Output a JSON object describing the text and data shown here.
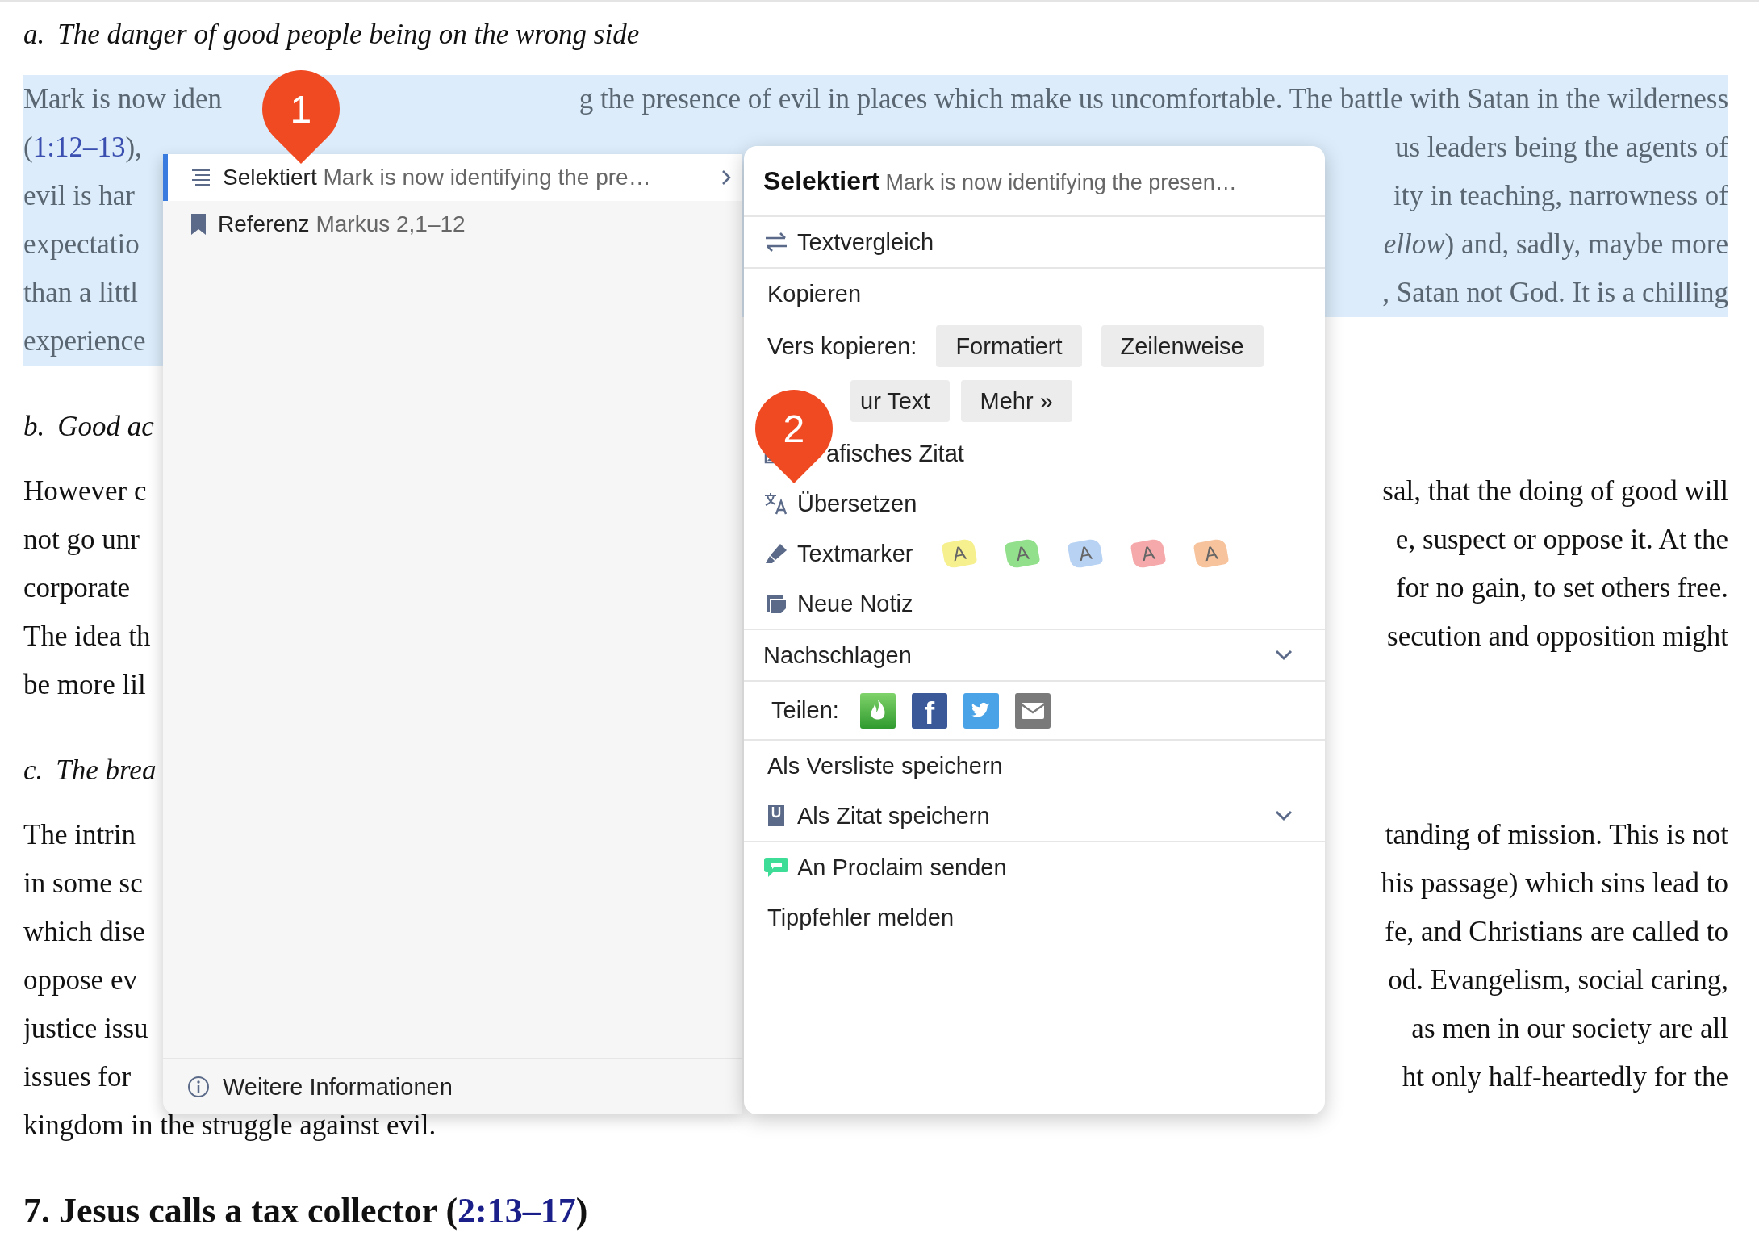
{
  "document": {
    "blocks": [
      {
        "kind": "subheading",
        "label": "a.",
        "title": "The danger of good people being on the wrong side"
      },
      {
        "kind": "paragraph",
        "lines": [
          {
            "selected": true,
            "left": "Mark is now iden",
            "right": "g the presence of evil in places which make us uncomfortable. The battle with Satan in the wilderness"
          },
          {
            "selected": true,
            "left": [
              {
                "kind": "text",
                "text": "("
              },
              {
                "kind": "link",
                "text": "1:12–13"
              },
              {
                "kind": "text",
                "text": "),"
              }
            ],
            "right": "us leaders being the agents of"
          },
          {
            "selected": true,
            "left": "evil is har",
            "right": "ity in teaching, narrowness of"
          },
          {
            "selected": true,
            "left": "expectatio",
            "right": "*ellow*) and, sadly, maybe more"
          },
          {
            "selected": true,
            "left": "than a littl",
            "right": ", Satan not God. It is a chilling"
          },
          {
            "selected": true,
            "left": "experience"
          }
        ]
      },
      {
        "kind": "subheading",
        "label": "b.",
        "title": "Good ac"
      },
      {
        "kind": "paragraph",
        "lines": [
          {
            "selected": false,
            "left": "However c",
            "right": "sal, that the doing of good will"
          },
          {
            "selected": false,
            "left": "not go unr",
            "right": "e, suspect or oppose it.  At the"
          },
          {
            "selected": false,
            "left": "corporate",
            "right": "for no gain, to set others free."
          },
          {
            "selected": false,
            "left": "The idea th",
            "right": "secution and opposition might"
          },
          {
            "selected": false,
            "left": "be more lil"
          }
        ]
      },
      {
        "kind": "subheading",
        "label": "c.",
        "title": "The brea"
      },
      {
        "kind": "paragraph",
        "lines": [
          {
            "selected": false,
            "left": "The intrin",
            "right": "tanding of mission. This is not"
          },
          {
            "selected": false,
            "left": "in some sc",
            "right": "his passage) which sins lead to"
          },
          {
            "selected": false,
            "left": "which dise",
            "right": "fe, and Christians are called to"
          },
          {
            "selected": false,
            "left": "oppose ev",
            "right": "od. Evangelism, social caring,"
          },
          {
            "selected": false,
            "left": "justice issu",
            "right": "as men in our society are all"
          },
          {
            "selected": false,
            "left": "issues for",
            "right": "ht only half-heartedly for the"
          },
          {
            "selected": false,
            "left": "kingdom in the struggle against evil."
          }
        ]
      },
      {
        "kind": "heading",
        "segments": [
          {
            "kind": "text",
            "text": "7. Jesus calls a tax collector ("
          },
          {
            "kind": "link",
            "text": "2:13–17"
          },
          {
            "kind": "text",
            "text": ")"
          }
        ]
      }
    ]
  },
  "popup": {
    "context_items": [
      {
        "kind": "selection",
        "label": "Selektiert",
        "detail": "Mark is now identifying the pre…",
        "selected": true
      },
      {
        "kind": "reference",
        "label": "Referenz",
        "detail": "Markus 2,1–12",
        "selected": false
      }
    ],
    "footer": "Weitere Informationen",
    "header": {
      "label": "Selektiert",
      "detail": "Mark is now identifying the presen…"
    },
    "sections": [
      [
        {
          "kind": "compare",
          "label": "Textvergleich"
        }
      ],
      [
        {
          "kind": "label",
          "label": "Kopieren"
        },
        {
          "kind": "buttons",
          "label": "Vers kopieren:",
          "buttons": [
            "Formatiert",
            "Zeilenweise"
          ]
        },
        {
          "kind": "buttons",
          "buttons": [
            "ur Text",
            "Mehr »"
          ]
        },
        {
          "kind": "quote",
          "label": "afisches Zitat"
        },
        {
          "kind": "translate",
          "label": "Übersetzen"
        },
        {
          "kind": "highlighter",
          "label": "Textmarker",
          "swatches": [
            {
              "label": "A",
              "color": "#f6f08e"
            },
            {
              "label": "A",
              "color": "#93e08c"
            },
            {
              "label": "A",
              "color": "#b8d2f4"
            },
            {
              "label": "A",
              "color": "#f5a9ab"
            },
            {
              "label": "A",
              "color": "#f7c39c"
            }
          ]
        },
        {
          "kind": "note",
          "label": "Neue Notiz"
        }
      ],
      [
        {
          "kind": "dropdown",
          "label": "Nachschlagen"
        }
      ],
      [
        {
          "kind": "share",
          "label": "Teilen:",
          "targets": [
            {
              "kind": "flame"
            },
            {
              "kind": "facebook",
              "glyph": "f"
            },
            {
              "kind": "twitter"
            },
            {
              "kind": "mail"
            }
          ]
        }
      ],
      [
        {
          "kind": "label",
          "label": "Als Versliste speichern"
        },
        {
          "kind": "save-dropdown",
          "label": "Als Zitat speichern"
        }
      ],
      [
        {
          "kind": "send",
          "label": "An Proclaim senden"
        },
        {
          "kind": "label",
          "label": "Tippfehler melden"
        }
      ]
    ]
  },
  "markers": [
    {
      "label": "1"
    },
    {
      "label": "2"
    }
  ]
}
